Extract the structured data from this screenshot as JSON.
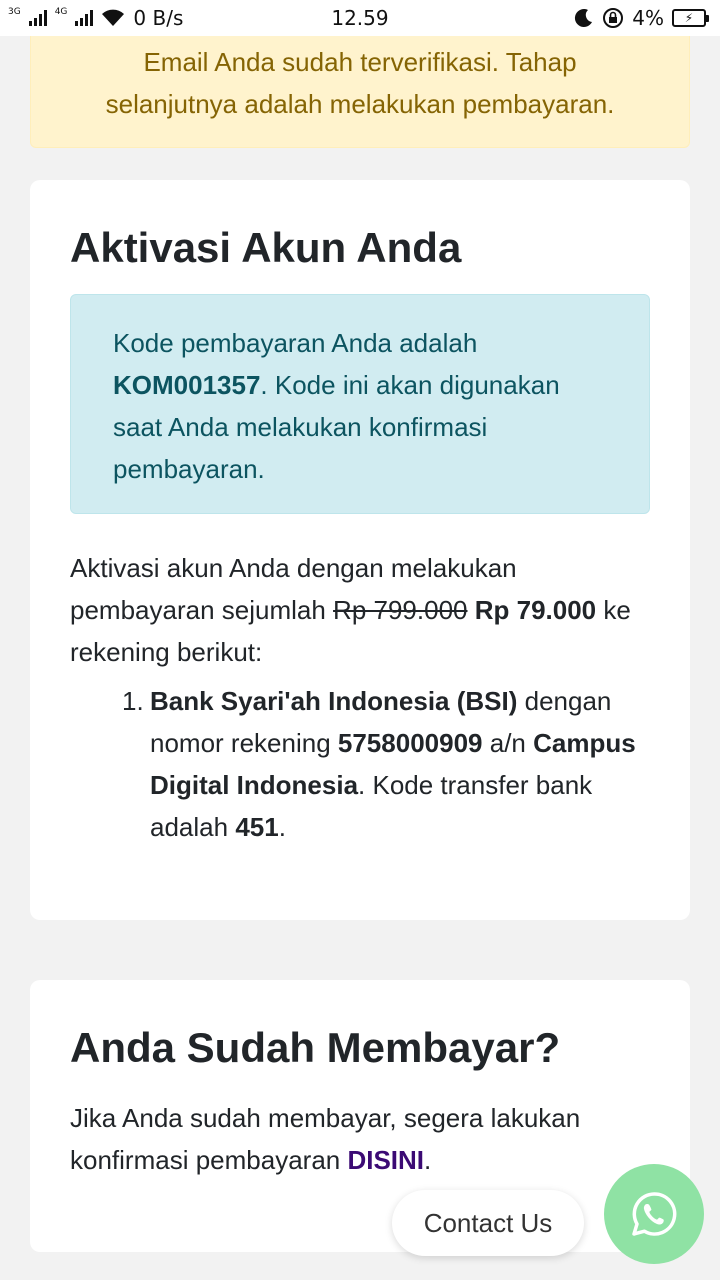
{
  "status_bar": {
    "network_1": "3G",
    "network_2": "4G",
    "speed": "0 B/s",
    "time": "12.59",
    "battery": "4%"
  },
  "alert": {
    "line1": "Email Anda sudah terverifikasi. Tahap",
    "line2": "selanjutnya adalah melakukan pembayaran."
  },
  "activation": {
    "title": "Aktivasi Akun Anda",
    "info_prefix": "Kode pembayaran Anda adalah",
    "payment_code": "KOM001357",
    "info_suffix": ". Kode ini akan digunakan saat Anda melakukan konfirmasi pembayaran.",
    "desc_prefix": "Aktivasi akun Anda dengan melakukan pembayaran sejumlah",
    "old_price": "Rp 799.000",
    "new_price": "Rp 79.000",
    "desc_suffix": "ke rekening berikut:",
    "bank": {
      "number": "1.",
      "name": "Bank Syari'ah Indonesia (BSI)",
      "text1": "dengan nomor rekening",
      "account": "5758000909",
      "text2": "a/n",
      "holder": "Campus Digital Indonesia",
      "text3": ". Kode transfer bank adalah",
      "transfer_code": "451",
      "text4": "."
    }
  },
  "confirm": {
    "title": "Anda Sudah Membayar?",
    "text": "Jika Anda sudah membayar, segera lakukan konfirmasi pembayaran",
    "link": "DISINI",
    "end": "."
  },
  "floating": {
    "contact_label": "Contact Us",
    "whatsapp_icon": "whatsapp-icon"
  },
  "colors": {
    "warning_bg": "#fff3cd",
    "warning_text": "#856404",
    "info_bg": "#d1ecf1",
    "info_text": "#0c5460",
    "link": "#3b0a74",
    "whatsapp": "#8fe2a4"
  }
}
